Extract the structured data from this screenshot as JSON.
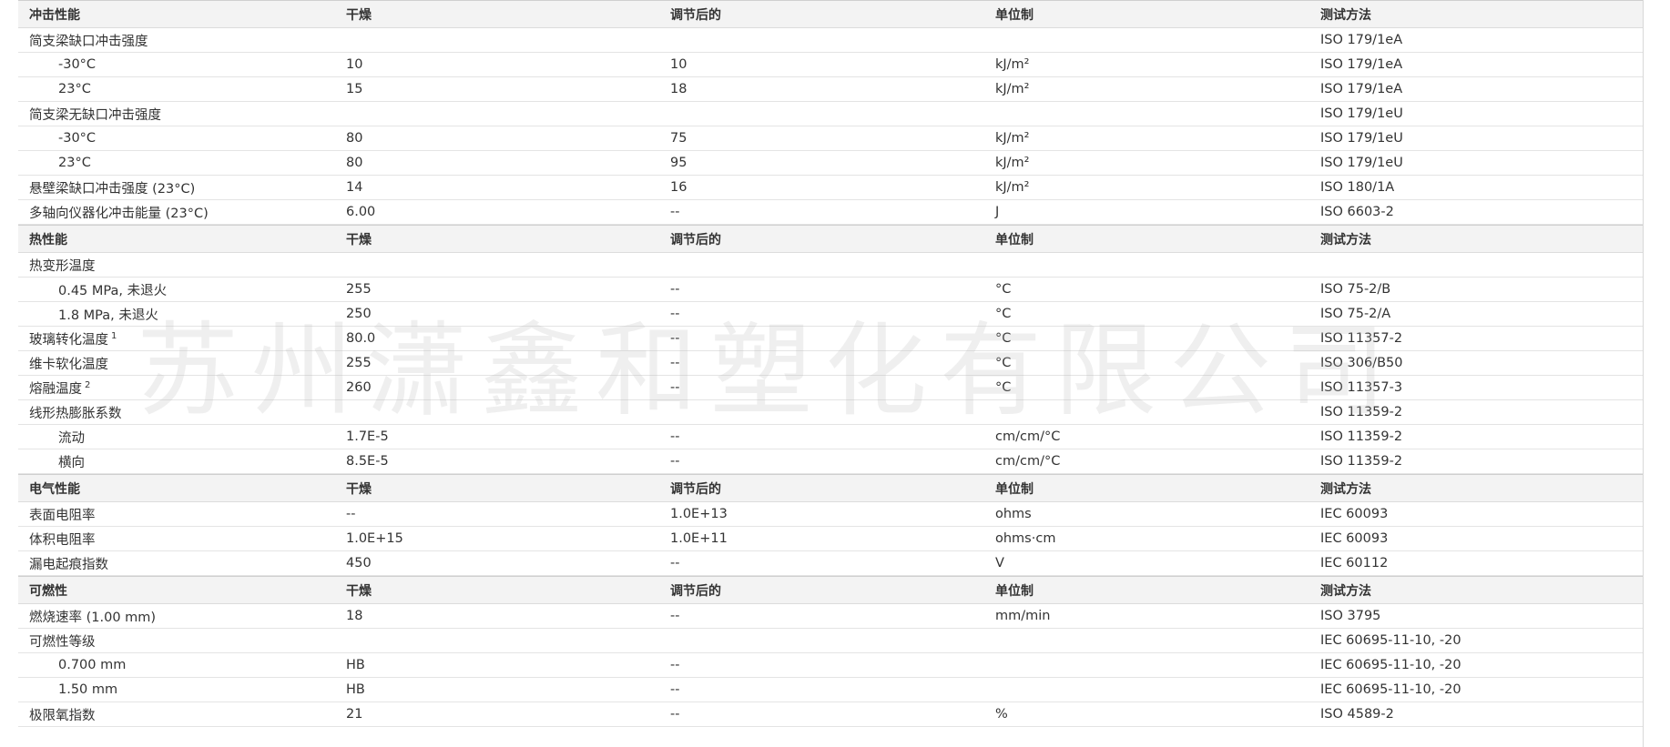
{
  "sections": [
    {
      "header": [
        "冲击性能",
        "干燥",
        "调节后的",
        "单位制",
        "测试方法"
      ],
      "rows": [
        {
          "name": "简支梁缺口冲击强度",
          "indent": false,
          "dry": "",
          "cond": "",
          "unit": "",
          "method": "ISO 179/1eA"
        },
        {
          "name": "-30°C",
          "indent": true,
          "dry": "10",
          "cond": "10",
          "unit": "kJ/m²",
          "method": "ISO 179/1eA"
        },
        {
          "name": "23°C",
          "indent": true,
          "dry": "15",
          "cond": "18",
          "unit": "kJ/m²",
          "method": "ISO 179/1eA"
        },
        {
          "name": "简支梁无缺口冲击强度",
          "indent": false,
          "dry": "",
          "cond": "",
          "unit": "",
          "method": "ISO 179/1eU"
        },
        {
          "name": "-30°C",
          "indent": true,
          "dry": "80",
          "cond": "75",
          "unit": "kJ/m²",
          "method": "ISO 179/1eU"
        },
        {
          "name": "23°C",
          "indent": true,
          "dry": "80",
          "cond": "95",
          "unit": "kJ/m²",
          "method": "ISO 179/1eU"
        },
        {
          "name": "悬壁梁缺口冲击强度 (23°C)",
          "indent": false,
          "dry": "14",
          "cond": "16",
          "unit": "kJ/m²",
          "method": "ISO 180/1A"
        },
        {
          "name": "多轴向仪器化冲击能量 (23°C)",
          "indent": false,
          "dry": "6.00",
          "cond": "--",
          "unit": "J",
          "method": "ISO 6603-2"
        }
      ]
    },
    {
      "header": [
        "热性能",
        "干燥",
        "调节后的",
        "单位制",
        "测试方法"
      ],
      "rows": [
        {
          "name": "热变形温度",
          "indent": false,
          "dry": "",
          "cond": "",
          "unit": "",
          "method": ""
        },
        {
          "name": "0.45 MPa, 未退火",
          "indent": true,
          "dry": "255",
          "cond": "--",
          "unit": "°C",
          "method": "ISO 75-2/B"
        },
        {
          "name": "1.8 MPa, 未退火",
          "indent": true,
          "dry": "250",
          "cond": "--",
          "unit": "°C",
          "method": "ISO 75-2/A"
        },
        {
          "name": "玻璃转化温度",
          "sup": "1",
          "indent": false,
          "dry": "80.0",
          "cond": "--",
          "unit": "°C",
          "method": "ISO 11357-2"
        },
        {
          "name": "维卡软化温度",
          "indent": false,
          "dry": "255",
          "cond": "--",
          "unit": "°C",
          "method": "ISO 306/B50"
        },
        {
          "name": "熔融温度",
          "sup": "2",
          "indent": false,
          "dry": "260",
          "cond": "--",
          "unit": "°C",
          "method": "ISO 11357-3"
        },
        {
          "name": "线形热膨胀系数",
          "indent": false,
          "dry": "",
          "cond": "",
          "unit": "",
          "method": "ISO 11359-2"
        },
        {
          "name": "流动",
          "indent": true,
          "dry": "1.7E-5",
          "cond": "--",
          "unit": "cm/cm/°C",
          "method": "ISO 11359-2"
        },
        {
          "name": "横向",
          "indent": true,
          "dry": "8.5E-5",
          "cond": "--",
          "unit": "cm/cm/°C",
          "method": "ISO 11359-2"
        }
      ]
    },
    {
      "header": [
        "电气性能",
        "干燥",
        "调节后的",
        "单位制",
        "测试方法"
      ],
      "rows": [
        {
          "name": "表面电阻率",
          "indent": false,
          "dry": "--",
          "cond": "1.0E+13",
          "unit": "ohms",
          "method": "IEC 60093"
        },
        {
          "name": "体积电阻率",
          "indent": false,
          "dry": "1.0E+15",
          "cond": "1.0E+11",
          "unit": "ohms·cm",
          "method": "IEC 60093"
        },
        {
          "name": "漏电起痕指数",
          "indent": false,
          "dry": "450",
          "cond": "--",
          "unit": "V",
          "method": "IEC 60112"
        }
      ]
    },
    {
      "header": [
        "可燃性",
        "干燥",
        "调节后的",
        "单位制",
        "测试方法"
      ],
      "rows": [
        {
          "name": "燃烧速率 (1.00 mm)",
          "indent": false,
          "dry": "18",
          "cond": "--",
          "unit": "mm/min",
          "method": "ISO 3795"
        },
        {
          "name": "可燃性等级",
          "indent": false,
          "dry": "",
          "cond": "",
          "unit": "",
          "method": "IEC 60695-11-10, -20"
        },
        {
          "name": "0.700 mm",
          "indent": true,
          "dry": "HB",
          "cond": "--",
          "unit": "",
          "method": "IEC 60695-11-10, -20"
        },
        {
          "name": "1.50 mm",
          "indent": true,
          "dry": "HB",
          "cond": "--",
          "unit": "",
          "method": "IEC 60695-11-10, -20"
        },
        {
          "name": "极限氧指数",
          "indent": false,
          "dry": "21",
          "cond": "--",
          "unit": "%",
          "method": "ISO 4589-2"
        }
      ]
    }
  ],
  "watermark": "苏州潇鑫和塑化有限公司"
}
